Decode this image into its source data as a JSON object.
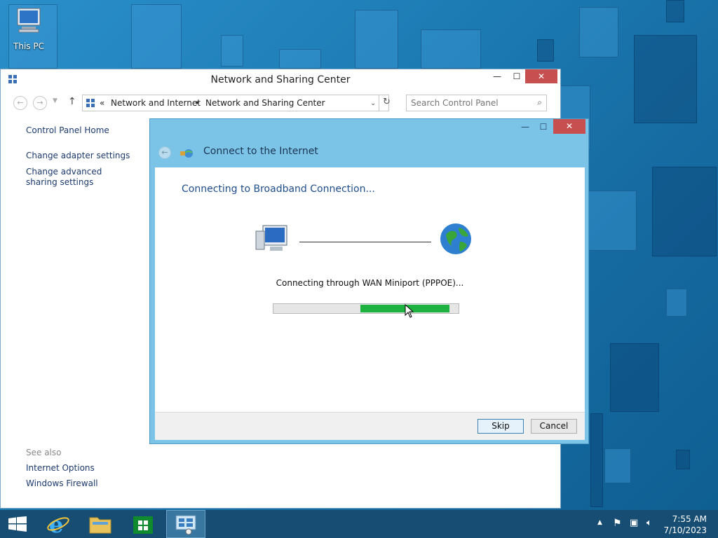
{
  "desktop": {
    "icon_label": "This PC"
  },
  "explorer": {
    "title": "Network and Sharing Center",
    "minimize": "—",
    "maximize": "☐",
    "close": "✕",
    "breadcrumb": {
      "prefix": "«",
      "part1": "Network and Internet",
      "sep": "▸",
      "part2": "Network and Sharing Center"
    },
    "search_placeholder": "Search Control Panel",
    "left_links": [
      "Control Panel Home",
      "Change adapter settings",
      "Change advanced sharing settings"
    ],
    "see_also": {
      "header": "See also",
      "links": [
        "Internet Options",
        "Windows Firewall"
      ]
    }
  },
  "dialog": {
    "window_title": "Connect to the Internet",
    "heading": "Connecting to Broadband Connection...",
    "status": "Connecting through WAN Miniport (PPPOE)...",
    "progress_segment": {
      "start_percent": 47,
      "end_percent": 95
    },
    "buttons": {
      "skip": "Skip",
      "cancel": "Cancel"
    }
  },
  "taskbar": {
    "items": [
      "start-icon",
      "internet-explorer-icon",
      "file-explorer-icon",
      "store-icon",
      "control-panel-icon"
    ],
    "clock_time": "7:55 AM",
    "clock_date": "7/10/2023"
  },
  "colors": {
    "accent": "#1eb340",
    "dialog_frame": "#7cc3e8",
    "taskbar": "#174d72",
    "close_button": "#c74f4f"
  }
}
